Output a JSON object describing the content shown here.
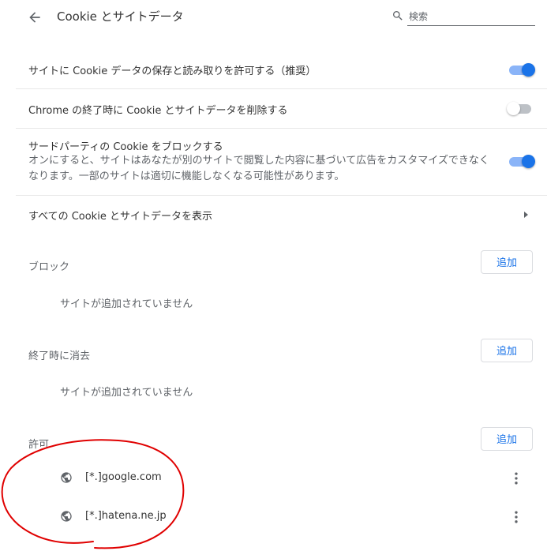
{
  "header": {
    "title": "Cookie とサイトデータ",
    "search_placeholder": "検索"
  },
  "settings": [
    {
      "label": "サイトに Cookie データの保存と読み取りを許可する（推奨）",
      "toggle": "on"
    },
    {
      "label": "Chrome の終了時に Cookie とサイトデータを削除する",
      "toggle": "off"
    },
    {
      "label": "サードパーティの Cookie をブロックする",
      "description": "オンにすると、サイトはあなたが別のサイトで閲覧した内容に基づいて広告をカスタマイズできなくなります。一部のサイトは適切に機能しなくなる可能性があります。",
      "toggle": "on"
    }
  ],
  "view_all": {
    "label": "すべての Cookie とサイトデータを表示"
  },
  "sections": {
    "block": {
      "title": "ブロック",
      "add_label": "追加",
      "empty_text": "サイトが追加されていません"
    },
    "clear_on_exit": {
      "title": "終了時に消去",
      "add_label": "追加",
      "empty_text": "サイトが追加されていません"
    },
    "allow": {
      "title": "許可",
      "add_label": "追加",
      "sites": [
        "[*.]google.com",
        "[*.]hatena.ne.jp"
      ]
    }
  },
  "colors": {
    "accent": "#1a73e8",
    "toggle_track_on": "#8ab4f8",
    "annotation": "#e00000"
  }
}
